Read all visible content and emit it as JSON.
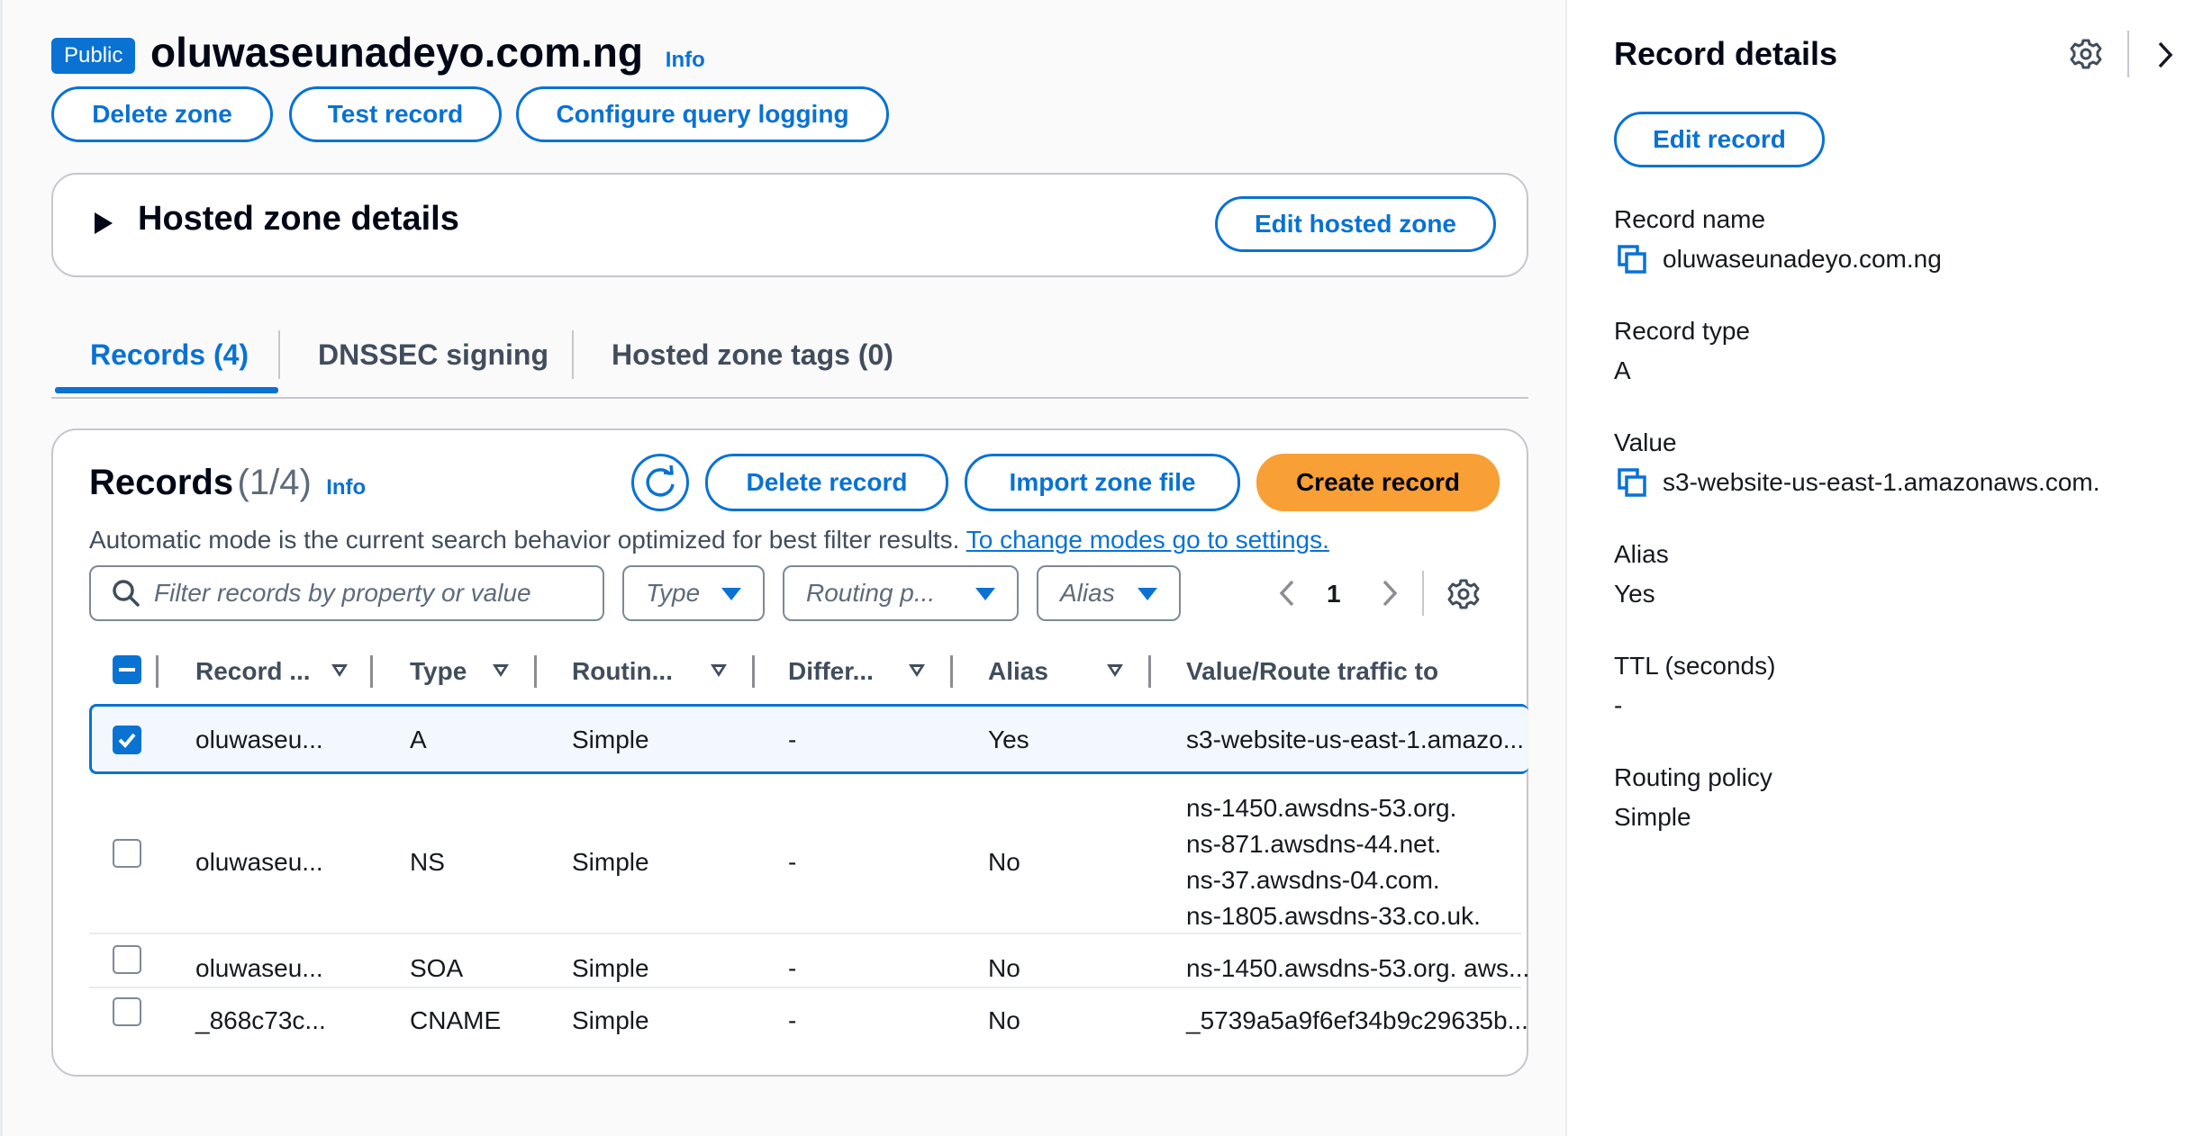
{
  "header": {
    "badge": "Public",
    "zone_name": "oluwaseunadeyo.com.ng",
    "info": "Info",
    "buttons": {
      "delete_zone": "Delete zone",
      "test_record": "Test record",
      "configure_query_logging": "Configure query logging"
    }
  },
  "hosted_zone_details": {
    "title": "Hosted zone details",
    "edit_button": "Edit hosted zone"
  },
  "tabs": [
    {
      "label": "Records (4)",
      "active": true
    },
    {
      "label": "DNSSEC signing",
      "active": false
    },
    {
      "label": "Hosted zone tags (0)",
      "active": false
    }
  ],
  "records_panel": {
    "title": "Records",
    "count": "(1/4)",
    "info": "Info",
    "delete_button": "Delete record",
    "import_button": "Import zone file",
    "create_button": "Create record",
    "description": "Automatic mode is the current search behavior optimized for best filter results.",
    "settings_link": "To change modes go to settings.",
    "search_placeholder": "Filter records by property or value",
    "filters": {
      "type": "Type",
      "routing": "Routing p...",
      "alias": "Alias"
    },
    "page_number": "1",
    "columns": [
      "Record ...",
      "Type",
      "Routin...",
      "Differ...",
      "Alias",
      "Value/Route traffic to"
    ],
    "rows": [
      {
        "selected": true,
        "name": "oluwaseu...",
        "type": "A",
        "routing": "Simple",
        "differ": "-",
        "alias": "Yes",
        "value": [
          "s3-website-us-east-1.amazo..."
        ]
      },
      {
        "selected": false,
        "name": "oluwaseu...",
        "type": "NS",
        "routing": "Simple",
        "differ": "-",
        "alias": "No",
        "value": [
          "ns-1450.awsdns-53.org.",
          "ns-871.awsdns-44.net.",
          "ns-37.awsdns-04.com.",
          "ns-1805.awsdns-33.co.uk."
        ]
      },
      {
        "selected": false,
        "name": "oluwaseu...",
        "type": "SOA",
        "routing": "Simple",
        "differ": "-",
        "alias": "No",
        "value": [
          "ns-1450.awsdns-53.org. aws..."
        ]
      },
      {
        "selected": false,
        "name": "_868c73c...",
        "type": "CNAME",
        "routing": "Simple",
        "differ": "-",
        "alias": "No",
        "value": [
          "_5739a5a9f6ef34b9c29635b..."
        ]
      }
    ]
  },
  "record_details": {
    "title": "Record details",
    "edit_button": "Edit record",
    "fields": {
      "record_name_label": "Record name",
      "record_name_value": "oluwaseunadeyo.com.ng",
      "record_type_label": "Record type",
      "record_type_value": "A",
      "value_label": "Value",
      "value_value": "s3-website-us-east-1.amazonaws.com.",
      "alias_label": "Alias",
      "alias_value": "Yes",
      "ttl_label": "TTL (seconds)",
      "ttl_value": "-",
      "routing_label": "Routing policy",
      "routing_value": "Simple"
    }
  },
  "colors": {
    "accent": "#0972d3",
    "primary_button": "#f89f35",
    "selected_row_bg": "#f2f8fd"
  },
  "icons": [
    "caret-right-icon",
    "refresh-icon",
    "search-icon",
    "chevron-left-icon",
    "chevron-right-icon",
    "settings-icon",
    "copy-icon",
    "sort-icon",
    "filter-caret-icon"
  ]
}
